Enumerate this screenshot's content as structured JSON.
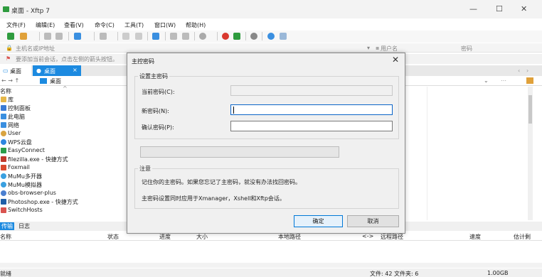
{
  "window": {
    "title": "桌面 - Xftp 7",
    "minimize": "—",
    "maximize": "☐",
    "close": "✕"
  },
  "menu": [
    "文件(F)",
    "编辑(E)",
    "查看(V)",
    "命令(C)",
    "工具(T)",
    "窗口(W)",
    "帮助(H)"
  ],
  "address": {
    "placeholder": "主机名或IP地址",
    "user_placeholder": "用户名",
    "password_placeholder": "密码"
  },
  "hint": {
    "text": "要添加当前会话，点击左侧的箭头按钮。"
  },
  "tabs": [
    {
      "label": "桌面",
      "icon": "monitor-icon"
    },
    {
      "label": "桌面",
      "icon": "dot-icon",
      "close": "×"
    }
  ],
  "path": {
    "nav": "← → ↑",
    "value": "桌面"
  },
  "filelist": {
    "header": "名称",
    "items": [
      {
        "name": "库",
        "icon": "library-icon",
        "color": "#e6b84a"
      },
      {
        "name": "控制面板",
        "icon": "control-panel-icon",
        "color": "#3a7bd5"
      },
      {
        "name": "此电脑",
        "icon": "computer-icon",
        "color": "#3a8fe0"
      },
      {
        "name": "网络",
        "icon": "network-icon",
        "color": "#3a8fe0"
      },
      {
        "name": "User",
        "icon": "user-icon",
        "color": "#d9a441"
      },
      {
        "name": "WPS云盘",
        "icon": "cloud-icon",
        "color": "#2d86e0"
      },
      {
        "name": "EasyConnect",
        "icon": "easyconnect-icon",
        "color": "#2a9d4a"
      },
      {
        "name": "filezilla.exe - 快捷方式",
        "icon": "filezilla-icon",
        "color": "#c0392b"
      },
      {
        "name": "Foxmail",
        "icon": "foxmail-icon",
        "color": "#d94a2e"
      },
      {
        "name": "MuMu多开器",
        "icon": "mumu-icon",
        "color": "#3aa0e0"
      },
      {
        "name": "MuMu模拟器",
        "icon": "mumu-icon",
        "color": "#3aa0e0"
      },
      {
        "name": "obs-browser-plus",
        "icon": "obs-icon",
        "color": "#4a7fd0"
      },
      {
        "name": "Photoshop.exe - 快捷方式",
        "icon": "photoshop-icon",
        "color": "#1f5fa8"
      },
      {
        "name": "SwitchHosts",
        "icon": "switchhosts-icon",
        "color": "#d9534f"
      }
    ]
  },
  "transfer": {
    "tabs": [
      "传输",
      "日志"
    ],
    "columns": [
      "名称",
      "状态",
      "进度",
      "大小",
      "本地路径",
      "<->",
      "远程路径",
      "速度",
      "估计剩"
    ]
  },
  "status": {
    "left": "就绪",
    "files": "文件: 42  文件夹: 6",
    "size": "1.00GB"
  },
  "dialog": {
    "title": "主控密码",
    "close": "✕",
    "group_title": "设置主密码",
    "current_label": "当前密码(C):",
    "new_label": "新密码(N):",
    "confirm_label": "确认密码(P):",
    "note_title": "注意",
    "note1": "记住你的主密码。如果您忘记了主密码，就没有办法找回密码。",
    "note2": "主密码设置同时应用于Xmanager，Xshell和Xftp会话。",
    "ok": "确定",
    "cancel": "取消"
  },
  "colors": {
    "accent": "#1c8ae0",
    "default_button_border": "#0078d7"
  }
}
